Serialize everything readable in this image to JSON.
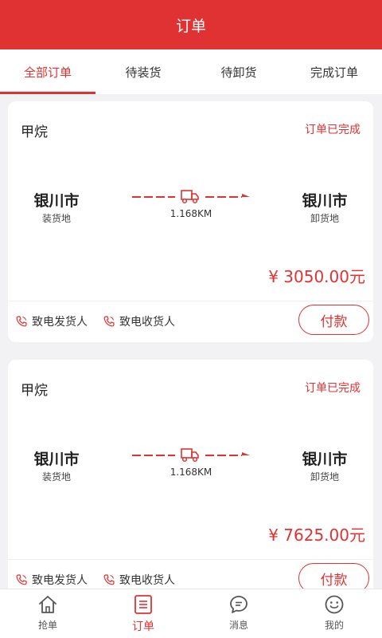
{
  "header": {
    "title": "订单"
  },
  "tabs": [
    {
      "label": "全部订单",
      "active": true
    },
    {
      "label": "待装货",
      "active": false
    },
    {
      "label": "待卸货",
      "active": false
    },
    {
      "label": "完成订单",
      "active": false
    }
  ],
  "orders": [
    {
      "goods": "甲烷",
      "status": "订单已完成",
      "origin_city": "银川市",
      "origin_label": "装货地",
      "dest_city": "银川市",
      "dest_label": "卸货地",
      "distance": "1.168KM",
      "price": "¥ 3050.00元",
      "call_shipper": "致电发货人",
      "call_receiver": "致电收货人",
      "pay_label": "付款"
    },
    {
      "goods": "甲烷",
      "status": "订单已完成",
      "origin_city": "银川市",
      "origin_label": "装货地",
      "dest_city": "银川市",
      "dest_label": "卸货地",
      "distance": "1.168KM",
      "price": "¥ 7625.00元",
      "call_shipper": "致电发货人",
      "call_receiver": "致电收货人",
      "pay_label": "付款"
    }
  ],
  "tabbar": [
    {
      "label": "抢单",
      "icon": "home-icon",
      "active": false
    },
    {
      "label": "订单",
      "icon": "order-list-icon",
      "active": true
    },
    {
      "label": "消息",
      "icon": "message-icon",
      "active": false
    },
    {
      "label": "我的",
      "icon": "smiley-icon",
      "active": false
    }
  ],
  "colors": {
    "accent": "#e03232",
    "background": "#f2f2f4"
  }
}
